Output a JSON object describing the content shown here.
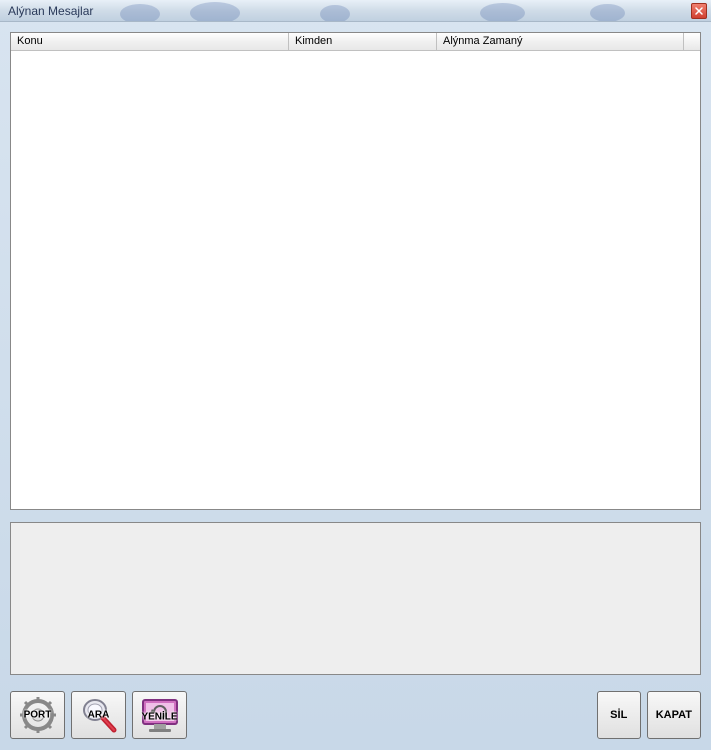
{
  "window": {
    "title": "Alýnan Mesajlar"
  },
  "table": {
    "columns": {
      "subject": "Konu",
      "from": "Kimden",
      "time": "Alýnma Zamaný"
    },
    "rows": []
  },
  "buttons": {
    "port": "PORT",
    "search": "ARA",
    "refresh": "YENİLE",
    "delete": "SİL",
    "close": "KAPAT"
  }
}
